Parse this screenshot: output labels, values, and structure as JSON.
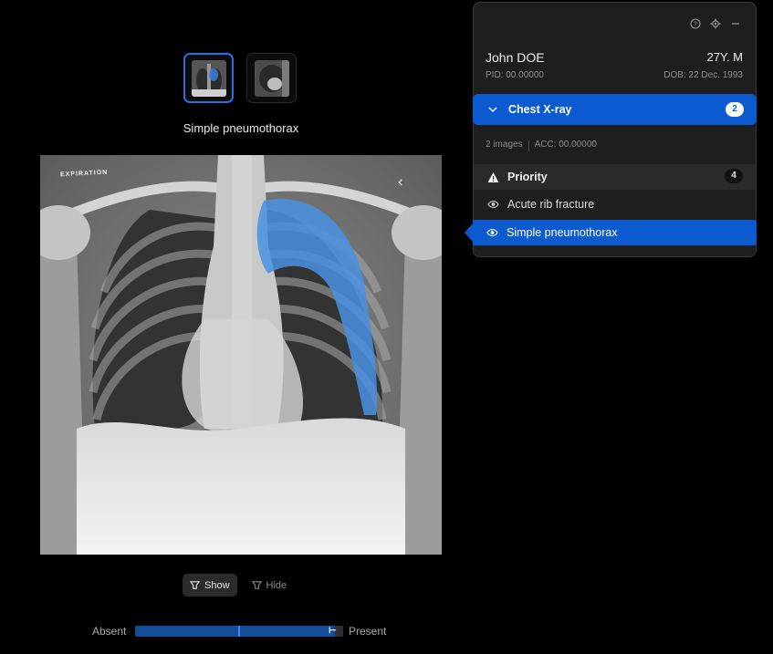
{
  "thumbnails": [
    {
      "name": "chest-xray-pa-thumbnail",
      "active": true
    },
    {
      "name": "chest-xray-lateral-thumbnail",
      "active": false
    }
  ],
  "viewer": {
    "finding_caption": "Simple pneumothorax",
    "image_label": "EXPIRATION",
    "overlay_color": "#4a90e2",
    "back_icon": "chevron-left-icon"
  },
  "toggle": {
    "show_label": "Show",
    "hide_label": "Hide",
    "active": "show",
    "icon": "spotlight-icon"
  },
  "slider": {
    "min_label": "Absent",
    "max_label": "Present",
    "value": 0.5,
    "fill": 0.96,
    "accent": "#124f98"
  },
  "panel": {
    "icons": [
      "help-icon",
      "settings-icon",
      "minimize-icon"
    ],
    "patient": {
      "name": "John DOE",
      "age_sex": "27Y. M",
      "pid": "PID: 00.00000",
      "dob": "DOB: 22 Dec. 1993"
    },
    "study": {
      "label": "Chest X-ray",
      "count": "2",
      "images": "2 images",
      "acc": "ACC: 00.00000"
    },
    "priority": {
      "label": "Priority",
      "count": "4"
    },
    "findings": [
      {
        "label": "Acute rib fracture",
        "selected": false
      },
      {
        "label": "Simple pneumothorax",
        "selected": true
      }
    ],
    "accent": "#0b5ad0"
  }
}
